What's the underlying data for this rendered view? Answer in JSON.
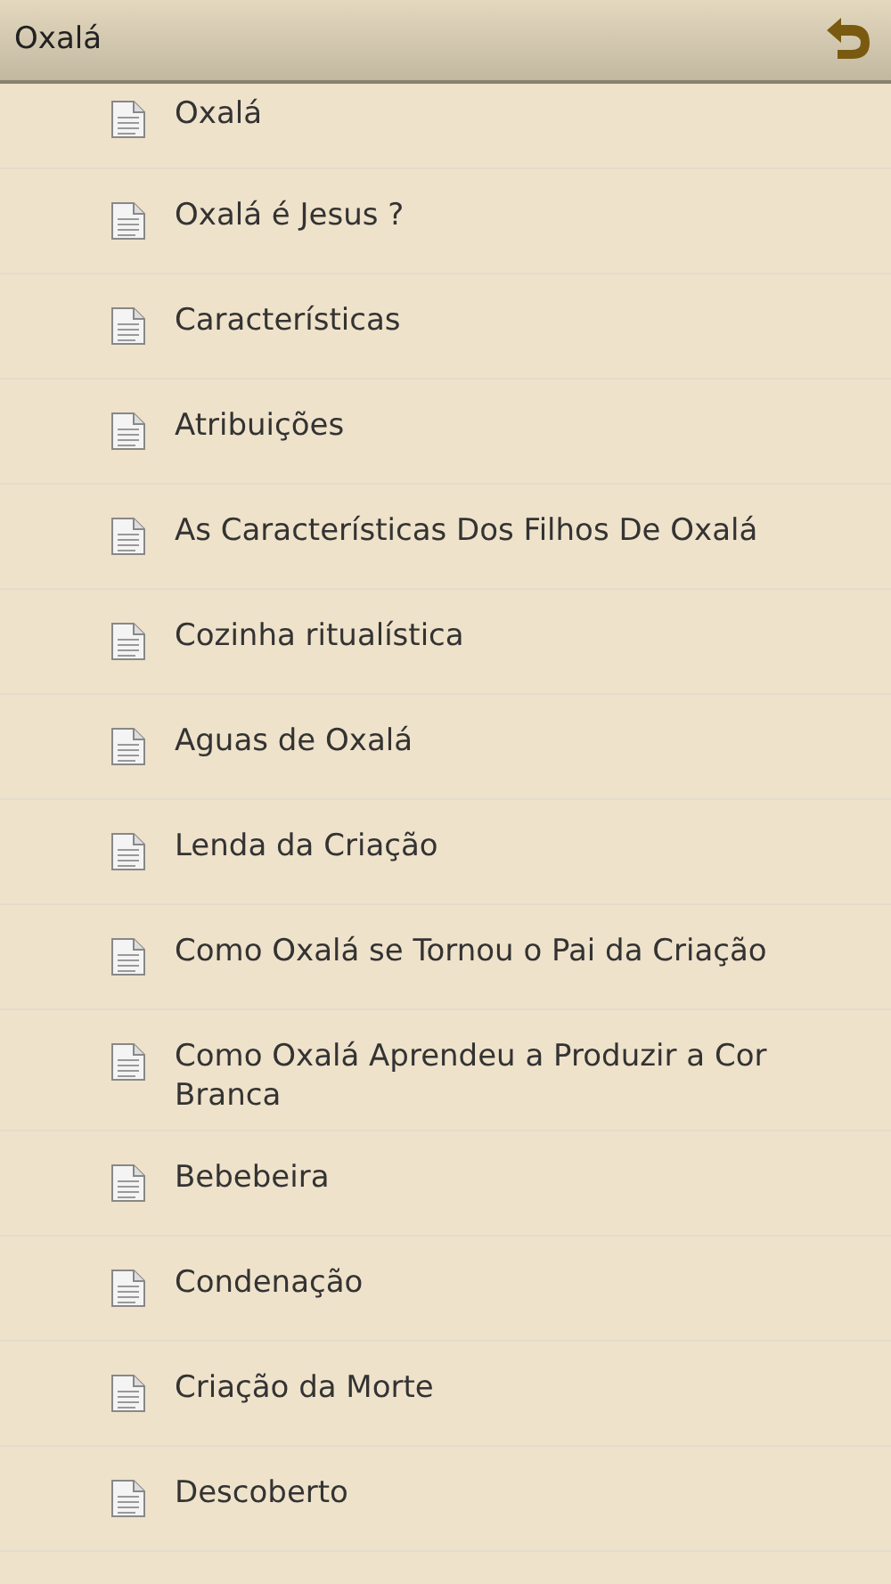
{
  "header": {
    "title": "Oxalá"
  },
  "items": [
    {
      "label": "Oxalá"
    },
    {
      "label": "Oxalá é Jesus ?"
    },
    {
      "label": "Características"
    },
    {
      "label": "Atribuições"
    },
    {
      "label": "As Características Dos Filhos De Oxalá"
    },
    {
      "label": "Cozinha ritualística"
    },
    {
      "label": "Aguas de Oxalá"
    },
    {
      "label": "Lenda da Criação"
    },
    {
      "label": "Como Oxalá se Tornou o Pai da Criação"
    },
    {
      "label": "Como Oxalá Aprendeu a Produzir a Cor Branca"
    },
    {
      "label": "Bebebeira"
    },
    {
      "label": "Condenação"
    },
    {
      "label": "Criação da Morte"
    },
    {
      "label": "Descoberto"
    }
  ]
}
